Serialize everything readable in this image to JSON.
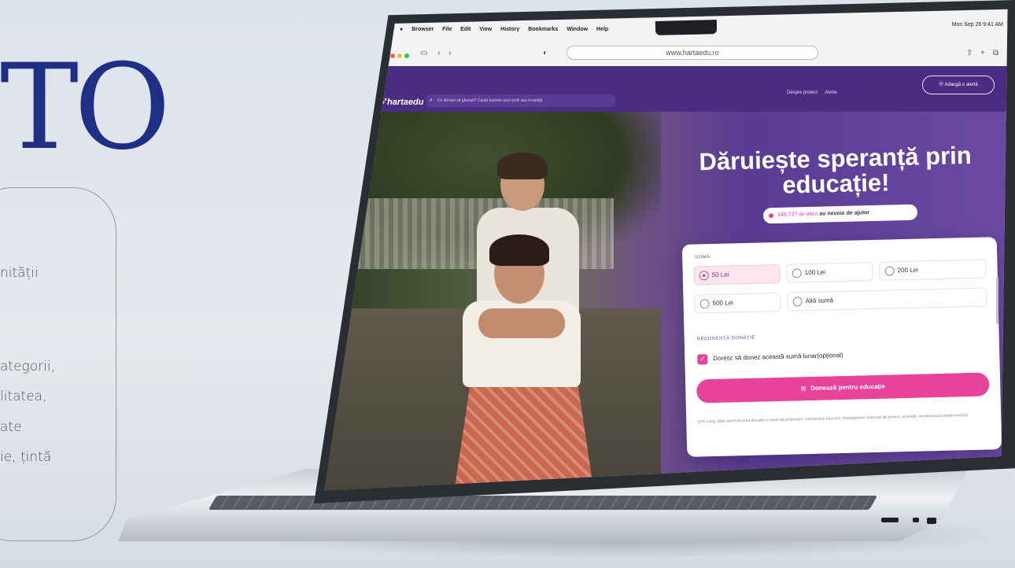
{
  "slide": {
    "big_text": "TO",
    "lines": [
      "nității",
      "ategorii,",
      "litatea,",
      "ate",
      "ie, țintă"
    ]
  },
  "browser": {
    "menu": [
      "Browser",
      "File",
      "Edit",
      "View",
      "History",
      "Bookmarks",
      "Window",
      "Help"
    ],
    "clock": "Mon Sep 26 9:41 AM",
    "url": "www.hartaedu.ro"
  },
  "site": {
    "logo": "hartaedu",
    "search_placeholder": "Ce dorești să găsești? Caută numele unei școli sau localități",
    "nav": {
      "about": "Despre proiect",
      "alerts": "Alerte",
      "add_alert": "Adaugă o alertă"
    },
    "hero": {
      "title": "Dăruiește speranță prin educație!",
      "pill_number": "348.737 de elevi",
      "pill_text": "au nevoie de ajutor"
    },
    "form": {
      "amount_label": "SUMA",
      "options": [
        "50 Lei",
        "100 Lei",
        "200 Lei",
        "500 Lei",
        "Altă sumă"
      ],
      "selected_option": "50 Lei",
      "recurrence_label": "RECURENȚĂ DONAȚIE",
      "recurrence_checkbox": "Doresc să donez această sumă lunar(opțional)",
      "recurrence_checked": true,
      "submit": "Donează pentru educație",
      "footnote": "20% merg către administrarea donației (costuri de procesare, comisioane bancare, management financiar de proiect, activități, monitorizarea implementării)"
    }
  },
  "colors": {
    "brand_purple": "#4a2c83",
    "accent_pink": "#e8439a",
    "slide_blue": "#1f2f86"
  }
}
